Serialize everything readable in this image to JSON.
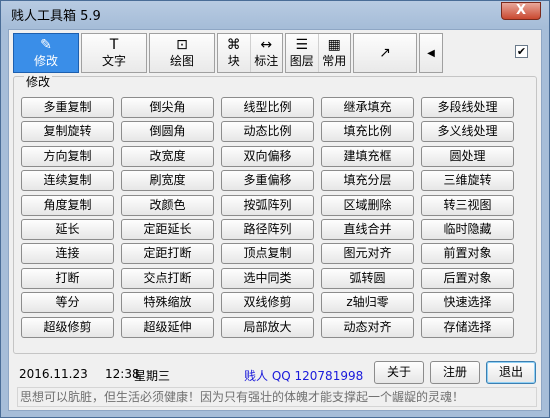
{
  "window": {
    "title": "贱人工具箱 5.9",
    "close_glyph": "X"
  },
  "toolbar": {
    "tabs": [
      {
        "label": "修改",
        "icon": "pencil-icon",
        "glyph": "✎"
      },
      {
        "label": "文字",
        "icon": "text-icon",
        "glyph": "T"
      },
      {
        "label": "绘图",
        "icon": "draw-icon",
        "glyph": "⊡"
      }
    ],
    "split_a": [
      {
        "label": "块",
        "icon": "block-icon",
        "glyph": "⌘"
      },
      {
        "label": "标注",
        "icon": "dimension-icon",
        "glyph": "↔"
      }
    ],
    "split_b": [
      {
        "label": "图层",
        "icon": "layers-icon",
        "glyph": "☰"
      },
      {
        "label": "常用",
        "icon": "favorites-icon",
        "glyph": "▦"
      }
    ],
    "export_glyph": "↗",
    "nav_left_glyph": "◀",
    "checkbox_checked": "✔"
  },
  "group": {
    "title": "修改",
    "buttons": [
      [
        "多重复制",
        "倒尖角",
        "线型比例",
        "继承填充",
        "多段线处理"
      ],
      [
        "复制旋转",
        "倒圆角",
        "动态比例",
        "填充比例",
        "多义线处理"
      ],
      [
        "方向复制",
        "改宽度",
        "双向偏移",
        "建填充框",
        "圆处理"
      ],
      [
        "连续复制",
        "刷宽度",
        "多重偏移",
        "填充分层",
        "三维旋转"
      ],
      [
        "角度复制",
        "改颜色",
        "按弧阵列",
        "区域删除",
        "转三视图"
      ],
      [
        "延长",
        "定距延长",
        "路径阵列",
        "直线合并",
        "临时隐藏"
      ],
      [
        "连接",
        "定距打断",
        "顶点复制",
        "图元对齐",
        "前置对象"
      ],
      [
        "打断",
        "交点打断",
        "选中同类",
        "弧转圆",
        "后置对象"
      ],
      [
        "等分",
        "特殊缩放",
        "双线修剪",
        "z轴归零",
        "快速选择"
      ],
      [
        "超级修剪",
        "超级延伸",
        "局部放大",
        "动态对齐",
        "存储选择"
      ]
    ]
  },
  "status": {
    "date": "2016.11.23",
    "time": "12:38",
    "weekday": "星期三",
    "contact": "贱人 QQ 120781998",
    "about_label": "关于",
    "register_label": "注册",
    "exit_label": "退出",
    "motto": "思想可以肮脏，但生活必须健康！因为只有强壮的体魄才能支撑起一个龌龊的灵魂！"
  }
}
